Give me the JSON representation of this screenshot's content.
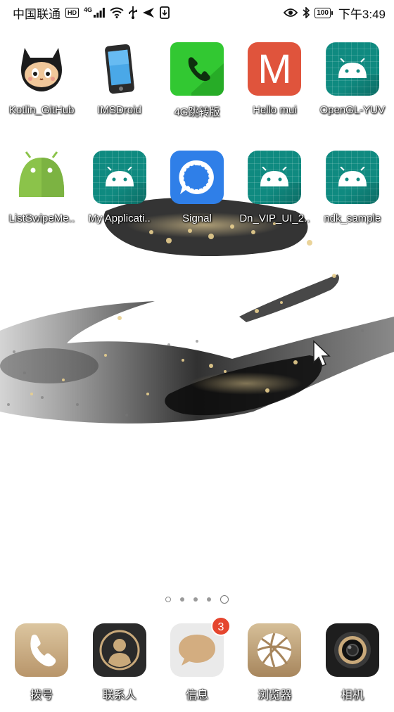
{
  "status_bar": {
    "carrier": "中国联通",
    "hd": "HD",
    "network": "4G",
    "battery": "100",
    "time": "下午3:49"
  },
  "home": {
    "row1": [
      {
        "label": "Kotlin_GitHub",
        "icon": "github-octocat-icon"
      },
      {
        "label": "IMSDroid",
        "icon": "phone-device-icon"
      },
      {
        "label": "4G跳转版",
        "icon": "phone-handset-icon"
      },
      {
        "label": "Hello mui",
        "icon": "letter-m-icon"
      },
      {
        "label": "OpenGL-YUV",
        "icon": "android-icon"
      }
    ],
    "row2": [
      {
        "label": "ListSwipeMe..",
        "icon": "android-robot-icon"
      },
      {
        "label": "My Applicati..",
        "icon": "android-icon"
      },
      {
        "label": "Signal",
        "icon": "signal-chat-icon"
      },
      {
        "label": "Dn_VIP_UI_2..",
        "icon": "android-icon"
      },
      {
        "label": "ndk_sample",
        "icon": "android-icon"
      }
    ],
    "m_letter": "M"
  },
  "dock": [
    {
      "label": "拨号",
      "icon": "phone-icon"
    },
    {
      "label": "联系人",
      "icon": "contacts-icon"
    },
    {
      "label": "信息",
      "icon": "message-icon",
      "badge": "3"
    },
    {
      "label": "浏览器",
      "icon": "browser-globe-icon"
    },
    {
      "label": "相机",
      "icon": "camera-icon"
    }
  ],
  "colors": {
    "android_teal": "#0f8a80",
    "signal_blue": "#2f7fe8",
    "badge_red": "#e5462f",
    "dock_gold": "#c9a97a"
  }
}
